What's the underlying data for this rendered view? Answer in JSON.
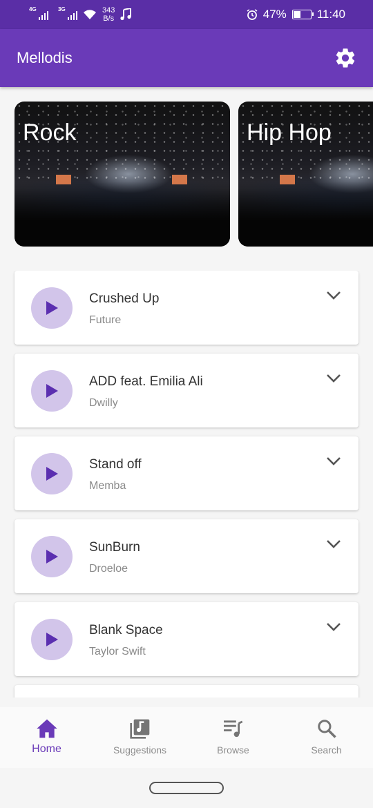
{
  "status_bar": {
    "network1": "4G",
    "network2": "3G",
    "speed_value": "343",
    "speed_unit": "B/s",
    "battery_percent": "47%",
    "battery_level": 0.47,
    "time": "11:40"
  },
  "app_bar": {
    "title": "Mellodis",
    "settings_icon": "gear-icon"
  },
  "genres": [
    {
      "label": "Rock"
    },
    {
      "label": "Hip Hop"
    }
  ],
  "songs": [
    {
      "title": "Crushed Up",
      "artist": "Future"
    },
    {
      "title": "ADD feat. Emilia Ali",
      "artist": "Dwilly"
    },
    {
      "title": "Stand off",
      "artist": "Memba"
    },
    {
      "title": "SunBurn",
      "artist": "Droeloe"
    },
    {
      "title": "Blank Space",
      "artist": "Taylor Swift"
    }
  ],
  "bottom_nav": {
    "items": [
      {
        "label": "Home",
        "icon": "home-icon",
        "active": true
      },
      {
        "label": "Suggestions",
        "icon": "music-library-icon",
        "active": false
      },
      {
        "label": "Browse",
        "icon": "playlist-icon",
        "active": false
      },
      {
        "label": "Search",
        "icon": "search-icon",
        "active": false
      }
    ]
  },
  "colors": {
    "primary": "#6a3ab8",
    "primary_dark": "#5a2ea6",
    "play_button_bg": "#d2c5ea",
    "play_icon": "#5b2fb0",
    "inactive_icon": "#757575"
  }
}
